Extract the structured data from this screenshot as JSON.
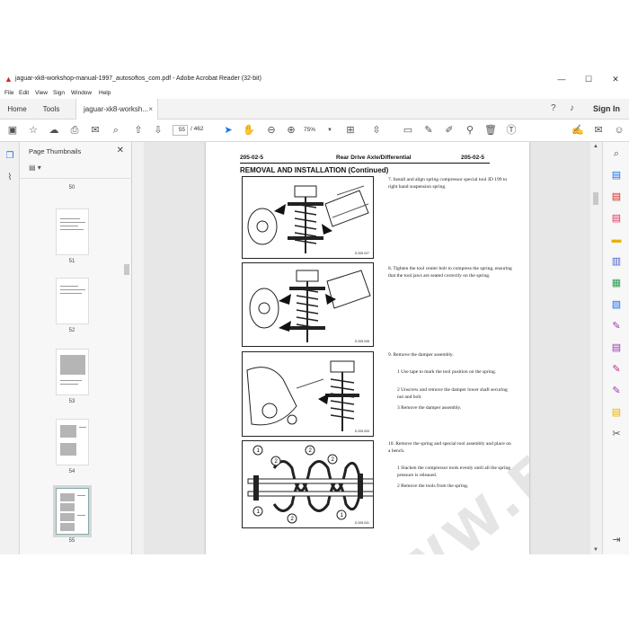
{
  "window": {
    "title": "jaguar-xk8-workshop-manual-1997_autosoftos_com.pdf - Adobe Acrobat Reader (32-bit)",
    "controls": {
      "minimize": "—",
      "maximize": "☐",
      "close": "✕"
    }
  },
  "menu": [
    "File",
    "Edit",
    "View",
    "Sign",
    "Window",
    "Help"
  ],
  "tabs": {
    "home": "Home",
    "tools": "Tools",
    "document": "jaguar-xk8-worksh...",
    "close": "×",
    "sign_in": "Sign In"
  },
  "toolbar": {
    "page_current": "55",
    "page_separator": "/",
    "page_total": "462",
    "zoom": "75%"
  },
  "thumbnails": {
    "title": "Page Thumbnails",
    "close": "✕",
    "pages": [
      "50",
      "51",
      "52",
      "53",
      "54",
      "55"
    ],
    "selected_page": "55"
  },
  "document": {
    "header_left": "205-02-5",
    "header_center": "Rear Drive Axle/Differential",
    "header_right": "205-02-5",
    "section_title": "REMOVAL AND INSTALLATION (Continued)",
    "watermark": "WWW.EPCATALOGO.COM",
    "figures": [
      {
        "code": "D.205.027"
      },
      {
        "code": "D.205.008"
      },
      {
        "code": "D.205.009"
      },
      {
        "code": "D.205.041",
        "callouts": [
          "1",
          "2",
          "2",
          "1",
          "2",
          "1",
          "2"
        ]
      }
    ],
    "steps": [
      {
        "text": "7.  Install and align spring compressor special tool JD 199 to right hand suspension spring.",
        "subs": []
      },
      {
        "text": "8.  Tighten the tool center bolt to compress the spring, ensuring that the tool jaws are seated correctly on the spring.",
        "subs": []
      },
      {
        "text": "9.  Remove the damper assembly.",
        "subs": [
          "1  Use tape to mark the tool position on the spring.",
          "2  Unscrew and remove the damper lower shaft securing nut and bolt.",
          "3  Remove the damper assembly."
        ]
      },
      {
        "text": "10. Remove the spring and special tool assembly and place on a bench.",
        "subs": [
          "1  Slacken the compressor tools evenly until all the spring pressure is released.",
          "2  Remove the tools from the spring."
        ]
      }
    ]
  },
  "colors": {
    "accent": "#1473e6",
    "brand_red": "#d3281c"
  }
}
